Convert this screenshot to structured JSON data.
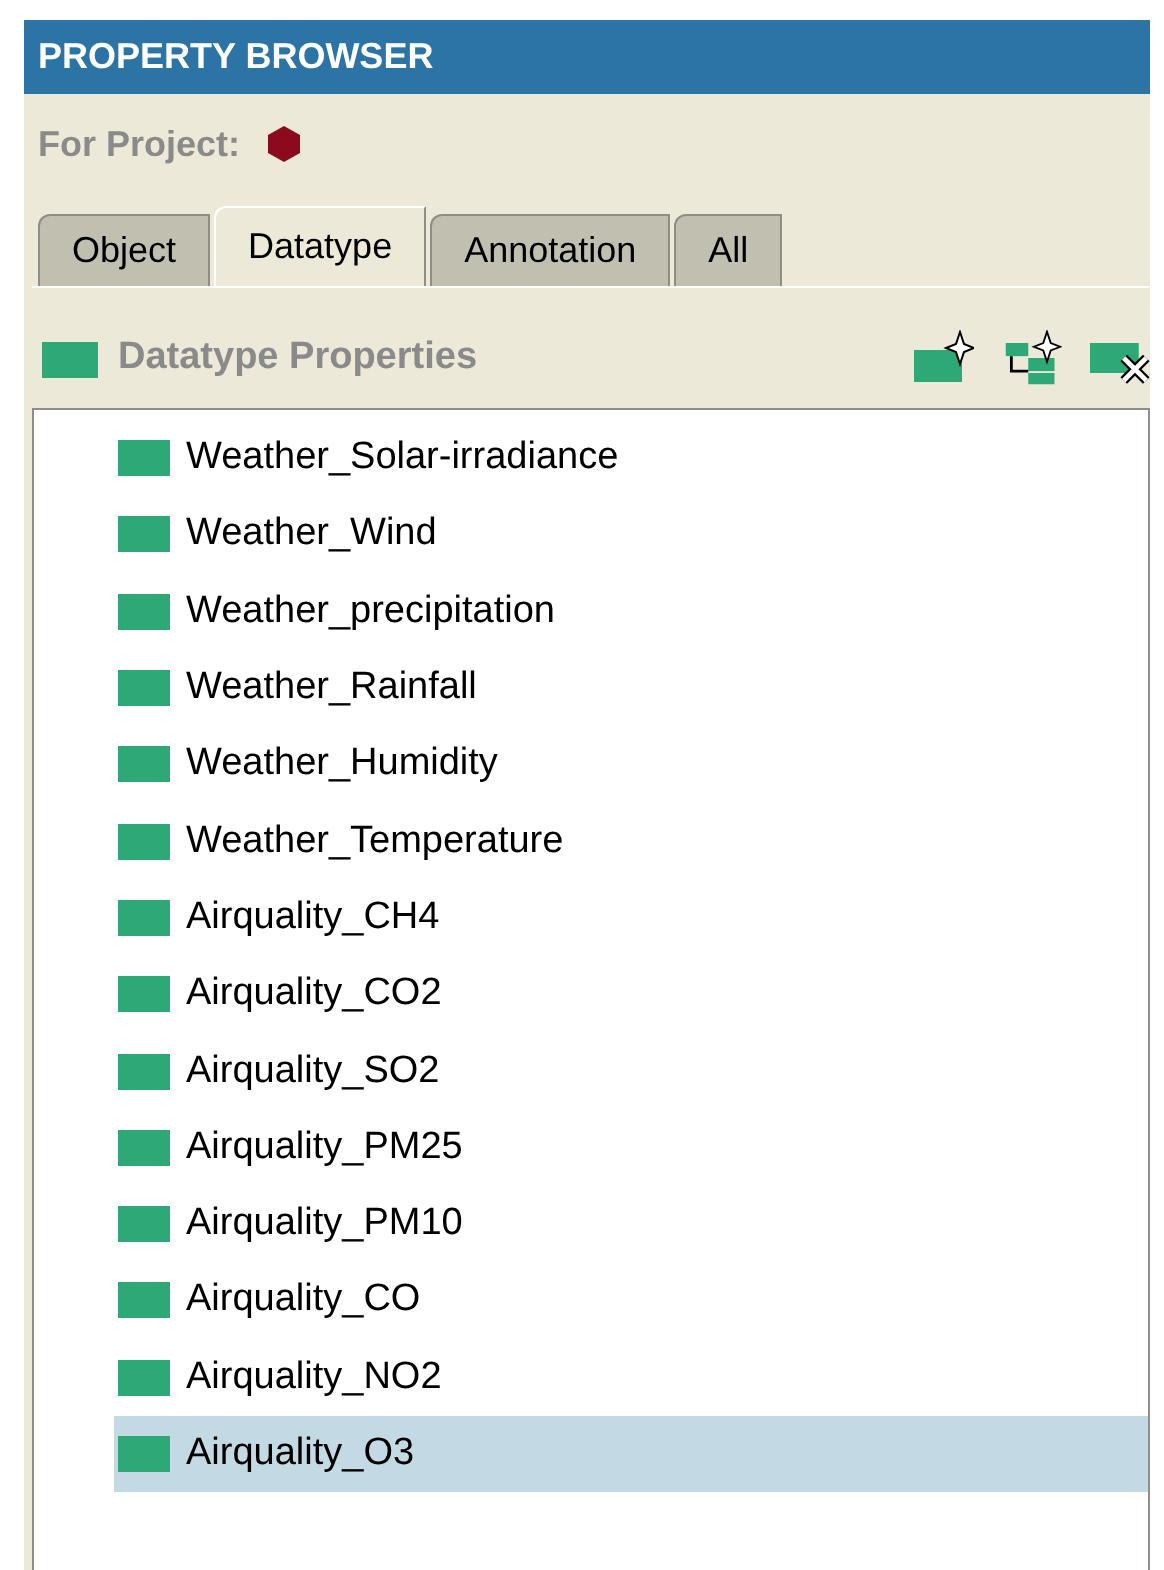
{
  "window": {
    "title": "PROPERTY BROWSER"
  },
  "project": {
    "label": "For Project:"
  },
  "tabs": [
    {
      "label": "Object",
      "selected": false
    },
    {
      "label": "Datatype",
      "selected": true
    },
    {
      "label": "Annotation",
      "selected": false
    },
    {
      "label": "All",
      "selected": false
    }
  ],
  "section": {
    "title": "Datatype Properties"
  },
  "properties": [
    {
      "name": "Weather_Solar-irradiance",
      "selected": false
    },
    {
      "name": "Weather_Wind",
      "selected": false
    },
    {
      "name": "Weather_precipitation",
      "selected": false
    },
    {
      "name": "Weather_Rainfall",
      "selected": false
    },
    {
      "name": "Weather_Humidity",
      "selected": false
    },
    {
      "name": "Weather_Temperature",
      "selected": false
    },
    {
      "name": "Airquality_CH4",
      "selected": false
    },
    {
      "name": "Airquality_CO2",
      "selected": false
    },
    {
      "name": "Airquality_SO2",
      "selected": false
    },
    {
      "name": "Airquality_PM25",
      "selected": false
    },
    {
      "name": "Airquality_PM10",
      "selected": false
    },
    {
      "name": "Airquality_CO",
      "selected": false
    },
    {
      "name": "Airquality_NO2",
      "selected": false
    },
    {
      "name": "Airquality_O3",
      "selected": true
    }
  ]
}
